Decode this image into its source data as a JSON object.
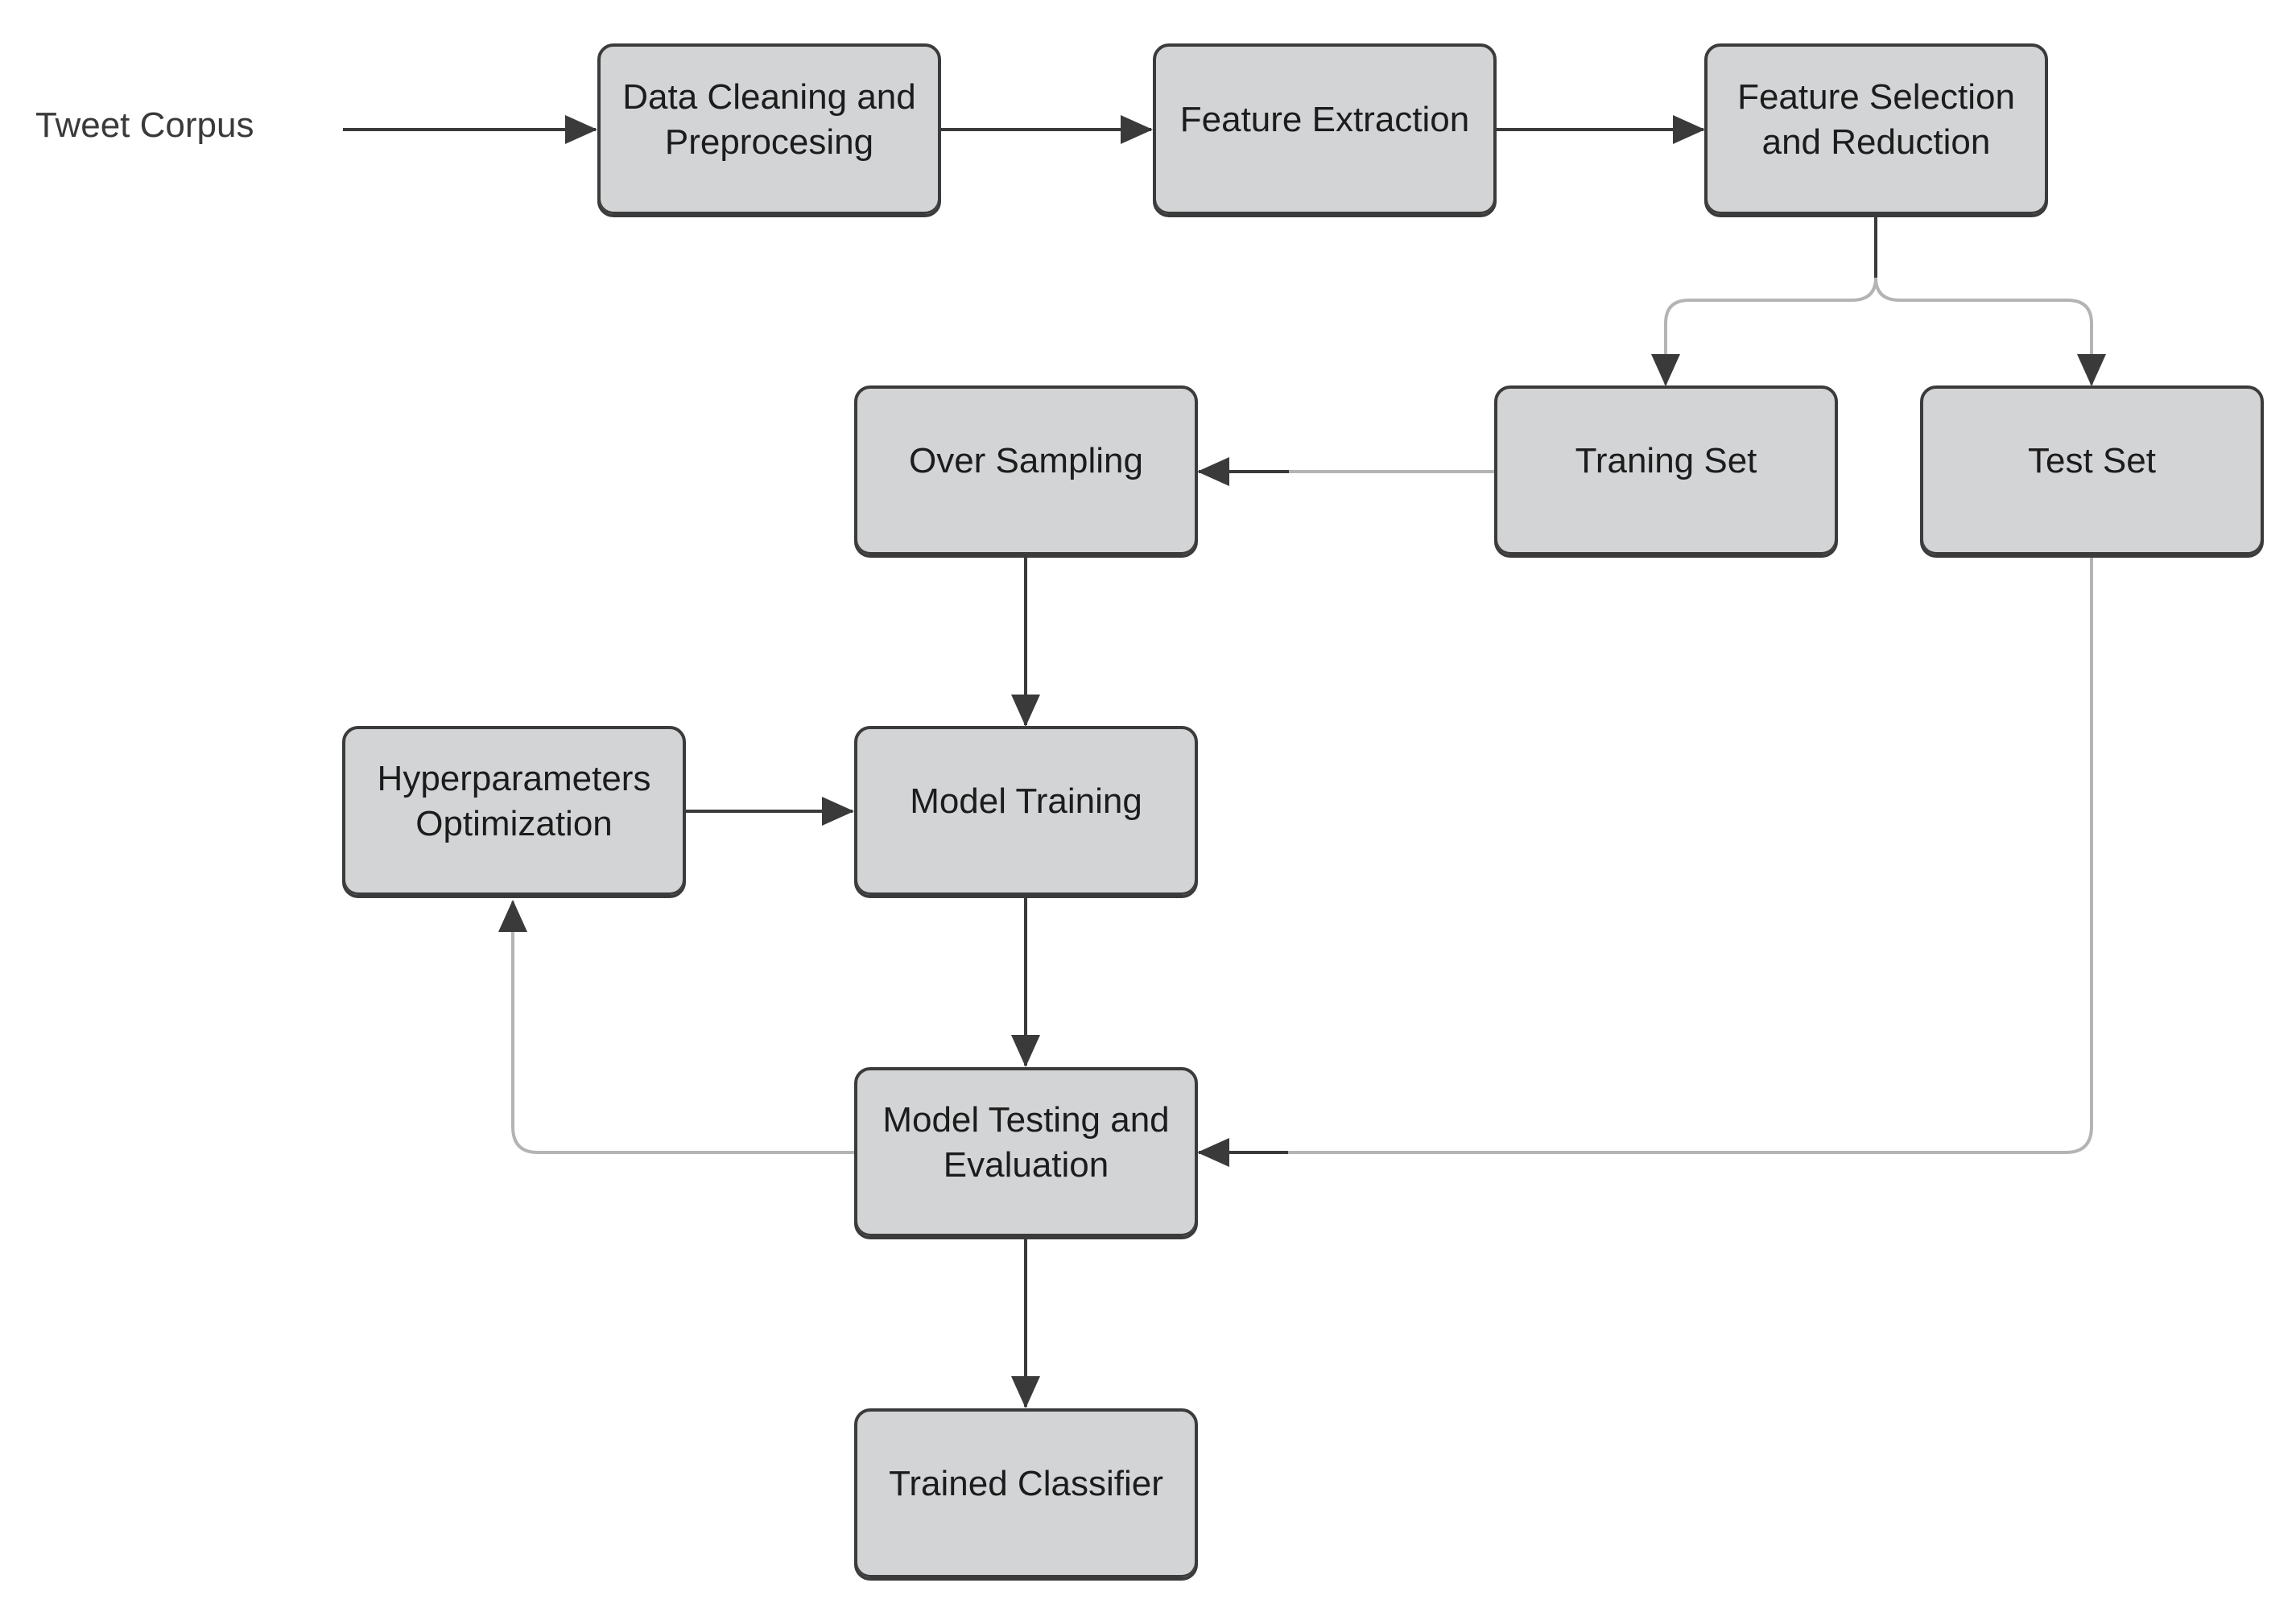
{
  "diagram": {
    "input_label": "Tweet Corpus",
    "nodes": [
      {
        "id": "cleaning",
        "label": "Data Cleaning and Preprocesing",
        "lines": [
          "Data Cleaning and",
          "Preprocesing"
        ]
      },
      {
        "id": "extraction",
        "label": "Feature Extraction",
        "lines": [
          "Feature Extraction"
        ]
      },
      {
        "id": "selection",
        "label": "Feature Selection and Reduction",
        "lines": [
          "Feature Selection",
          "and Reduction"
        ]
      },
      {
        "id": "training_set",
        "label": "Traning Set",
        "lines": [
          "Traning Set"
        ]
      },
      {
        "id": "test_set",
        "label": "Test Set",
        "lines": [
          "Test Set"
        ]
      },
      {
        "id": "oversampling",
        "label": "Over Sampling",
        "lines": [
          "Over Sampling"
        ]
      },
      {
        "id": "model_training",
        "label": "Model Training",
        "lines": [
          "Model Training"
        ]
      },
      {
        "id": "hyperparameters",
        "label": "Hyperparameters Optimization",
        "lines": [
          "Hyperparameters",
          "Optimization"
        ]
      },
      {
        "id": "testing",
        "label": "Model Testing and Evaluation",
        "lines": [
          "Model Testing and",
          "Evaluation"
        ]
      },
      {
        "id": "classifier",
        "label": "Trained Classifier",
        "lines": [
          "Trained Classifier"
        ]
      }
    ],
    "edges": [
      {
        "from": "input",
        "to": "cleaning"
      },
      {
        "from": "cleaning",
        "to": "extraction"
      },
      {
        "from": "extraction",
        "to": "selection"
      },
      {
        "from": "selection",
        "to": "training_set"
      },
      {
        "from": "selection",
        "to": "test_set"
      },
      {
        "from": "training_set",
        "to": "oversampling"
      },
      {
        "from": "oversampling",
        "to": "model_training"
      },
      {
        "from": "hyperparameters",
        "to": "model_training"
      },
      {
        "from": "model_training",
        "to": "testing"
      },
      {
        "from": "test_set",
        "to": "testing"
      },
      {
        "from": "testing",
        "to": "hyperparameters"
      },
      {
        "from": "testing",
        "to": "classifier"
      }
    ],
    "colors": {
      "node_fill": "#d3d4d6",
      "node_border": "#3b3b3b",
      "edge_dark": "#3a3a3a",
      "edge_light": "#b4b4b4",
      "text": "#1c1c1c"
    }
  }
}
